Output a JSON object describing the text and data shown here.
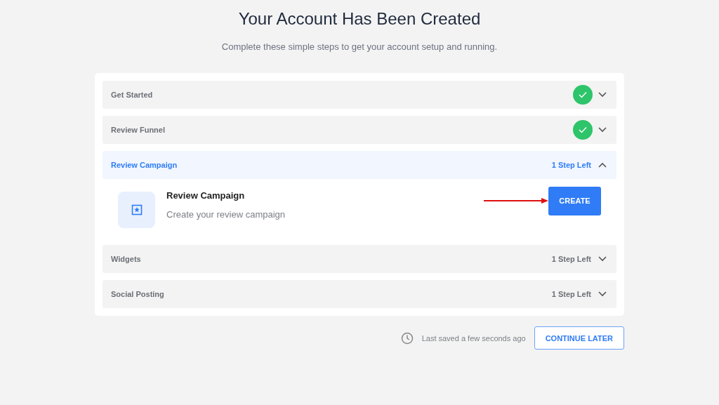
{
  "title": "Your Account Has Been Created",
  "subtitle": "Complete these simple steps to get your account setup and running.",
  "sections": [
    {
      "label": "Get Started",
      "done": true,
      "expanded": false
    },
    {
      "label": "Review Funnel",
      "done": true,
      "expanded": false
    },
    {
      "label": "Review Campaign",
      "done": false,
      "status": "1 Step Left",
      "expanded": true,
      "task": {
        "title": "Review Campaign",
        "description": "Create your review campaign",
        "button": "CREATE"
      }
    },
    {
      "label": "Widgets",
      "done": false,
      "status": "1 Step Left",
      "expanded": false
    },
    {
      "label": "Social Posting",
      "done": false,
      "status": "1 Step Left",
      "expanded": false
    }
  ],
  "footer": {
    "saved": "Last saved a few seconds ago",
    "button": "CONTINUE LATER"
  }
}
